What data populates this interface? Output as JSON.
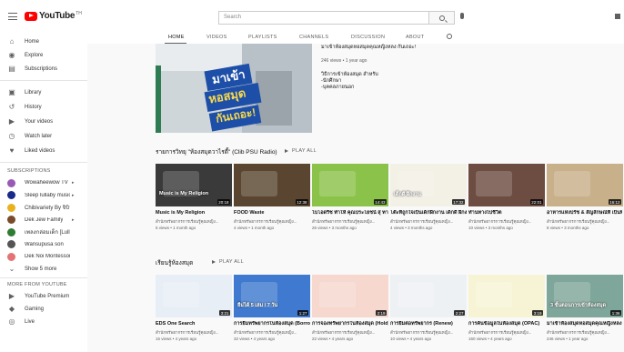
{
  "header": {
    "logo_text": "YouTube",
    "logo_sup": "TH",
    "search_placeholder": "Search"
  },
  "sidebar": {
    "main": [
      {
        "label": "Home",
        "icon": "home-icon"
      },
      {
        "label": "Explore",
        "icon": "explore-icon"
      },
      {
        "label": "Subscriptions",
        "icon": "subscriptions-icon"
      }
    ],
    "library": [
      {
        "label": "Library",
        "icon": "library-icon"
      },
      {
        "label": "History",
        "icon": "history-icon"
      },
      {
        "label": "Your videos",
        "icon": "your-videos-icon"
      },
      {
        "label": "Watch later",
        "icon": "watch-later-icon"
      },
      {
        "label": "Liked videos",
        "icon": "liked-videos-icon"
      }
    ],
    "subscriptions_heading": "SUBSCRIPTIONS",
    "subscriptions": [
      {
        "label": "Wowaheewow TV",
        "color": "#9b59b6",
        "arrow": true
      },
      {
        "label": "Sleep lullaby music",
        "color": "#1a2a8a",
        "arrow": true
      },
      {
        "label": "Chibivariety By จิบิว...",
        "color": "#e8b21f",
        "arrow": false
      },
      {
        "label": "Dek Jew Family",
        "color": "#7b4a2a",
        "arrow": true
      },
      {
        "label": "เพลงกล่อมเด็ก [Lullab...",
        "color": "#2e7d32",
        "arrow": false
      },
      {
        "label": "Wansupusa son",
        "color": "#555555",
        "arrow": false
      },
      {
        "label": "Dek Noi Montessori",
        "color": "#e57373",
        "arrow": false
      }
    ],
    "show_more": "Show 5 more",
    "more_heading": "MORE FROM YOUTUBE",
    "more": [
      {
        "label": "YouTube Premium",
        "icon": "youtube-premium-icon"
      },
      {
        "label": "Gaming",
        "icon": "gaming-icon"
      },
      {
        "label": "Live",
        "icon": "live-icon"
      }
    ]
  },
  "tabs": [
    {
      "label": "HOME",
      "active": true
    },
    {
      "label": "VIDEOS",
      "active": false
    },
    {
      "label": "PLAYLISTS",
      "active": false
    },
    {
      "label": "CHANNELS",
      "active": false
    },
    {
      "label": "DISCUSSION",
      "active": false
    },
    {
      "label": "ABOUT",
      "active": false
    }
  ],
  "featured": {
    "thumb_text_1": "มาเข้า",
    "thumb_text_2": "หอสมุด",
    "thumb_text_3": "กันเถอะ!",
    "top_line": "มาเข้าห้องสมุดหอสมุดคุณหญิงหลง กันเถอะ!",
    "stats": "246 views • 1 year ago",
    "desc_1": "วิธีการเข้าห้องสมุด สำหรับ",
    "desc_2": "-นักศึกษา",
    "desc_3": "-บุคคลภายนอก"
  },
  "shelves": [
    {
      "title": "รายการวิทยุ \"ห้องสมุดวาไรตี้\" (Clib PSU Radio)",
      "play_all": "PLAY ALL",
      "videos": [
        {
          "title": "Music is My Religion",
          "channel": "สำนักทรัพยากรการเรียนรู้คุณหญิง...",
          "stats": "5 views • 1 month ago",
          "duration": "20:18",
          "thumb_text": "Music is My Religion",
          "color": "#3a3a3a"
        },
        {
          "title": "FOOD Waste",
          "channel": "สำนักทรัพยากรการเรียนรู้คุณหญิง...",
          "stats": "4 views • 1 month ago",
          "duration": "12:38",
          "thumb_text": "",
          "color": "#5a4630"
        },
        {
          "title": "ไบโอดรีช ทำให้ คุณประโยชน์ สุ ทางเลือกใหม่ของวันสุขภาพ",
          "channel": "สำนักทรัพยากรการเรียนรู้คุณหญิง...",
          "stats": "26 views • 3 months ago",
          "duration": "14:43",
          "thumb_text": "",
          "color": "#8bc34a"
        },
        {
          "title": "โต๊ะที่ถูกใจเป็นเด็กฝึกงาน เด็กดี ฝึกงาน",
          "channel": "สำนักทรัพยากรการเรียนรู้คุณหญิง...",
          "stats": "4 views • 3 months ago",
          "duration": "17:32",
          "thumb_text": "เด็กดี ฝึกงาน",
          "color": "#f3f0e6"
        },
        {
          "title": "ทำนทางไปชีวิต",
          "channel": "สำนักทรัพยากรการเรียนรู้คุณหญิง...",
          "stats": "10 views • 3 months ago",
          "duration": "22:01",
          "thumb_text": "",
          "color": "#6d4c41"
        },
        {
          "title": "อาหารแห่งปรัช & สัญลักษณ์ที่ เป็นพิศรับเชื่อมวดหมัดเรียกรื้อ...",
          "channel": "สำนักทรัพยากรการเรียนรู้คุณหญิง...",
          "stats": "8 views • 3 months ago",
          "duration": "16:12",
          "thumb_text": "",
          "color": "#c8b08a"
        }
      ]
    },
    {
      "title": "เรียนรู้ห้องสมุด",
      "play_all": "PLAY ALL",
      "videos": [
        {
          "title": "EDS One Search",
          "channel": "สำนักทรัพยากรการเรียนรู้คุณหญิง...",
          "stats": "15 views • 4 years ago",
          "duration": "3:21",
          "thumb_text": "",
          "color": "#e8eef6"
        },
        {
          "title": "การยืมทรัพยากรในห้องสมุด (Borrow)",
          "channel": "สำนักทรัพยากรการเรียนรู้คุณหญิง...",
          "stats": "32 views • 4 years ago",
          "duration": "1:27",
          "thumb_text": "ยืมได้ 5 เล่ม / 7 วัน",
          "color": "#3f7ad0"
        },
        {
          "title": "การจองทรัพยากรในห้องสมุด (Hold)",
          "channel": "สำนักทรัพยากรการเรียนรู้คุณหญิง...",
          "stats": "22 views • 4 years ago",
          "duration": "2:19",
          "thumb_text": "",
          "color": "#f6d8cf"
        },
        {
          "title": "การยืมต่อทรัพยากร (Renew)",
          "channel": "สำนักทรัพยากรการเรียนรู้คุณหญิง...",
          "stats": "10 views • 4 years ago",
          "duration": "2:27",
          "thumb_text": "",
          "color": "#eef1f4"
        },
        {
          "title": "การค้นข้อมูลในห้องสมุด (OPAC)",
          "channel": "สำนักทรัพยากรการเรียนรู้คุณหญิง...",
          "stats": "160 views • 4 years ago",
          "duration": "3:19",
          "thumb_text": "",
          "color": "#f7f4d5"
        },
        {
          "title": "มาเข้าห้องสมุดหอสมุดคุณหญิงหลง กันเถอะ!",
          "channel": "สำนักทรัพยากรการเรียนรู้คุณหญิง...",
          "stats": "246 views • 1 year ago",
          "duration": "1:36",
          "thumb_text": "3 ขั้นตอนการเข้าห้องสมุด",
          "color": "#7fa69a"
        }
      ]
    }
  ]
}
